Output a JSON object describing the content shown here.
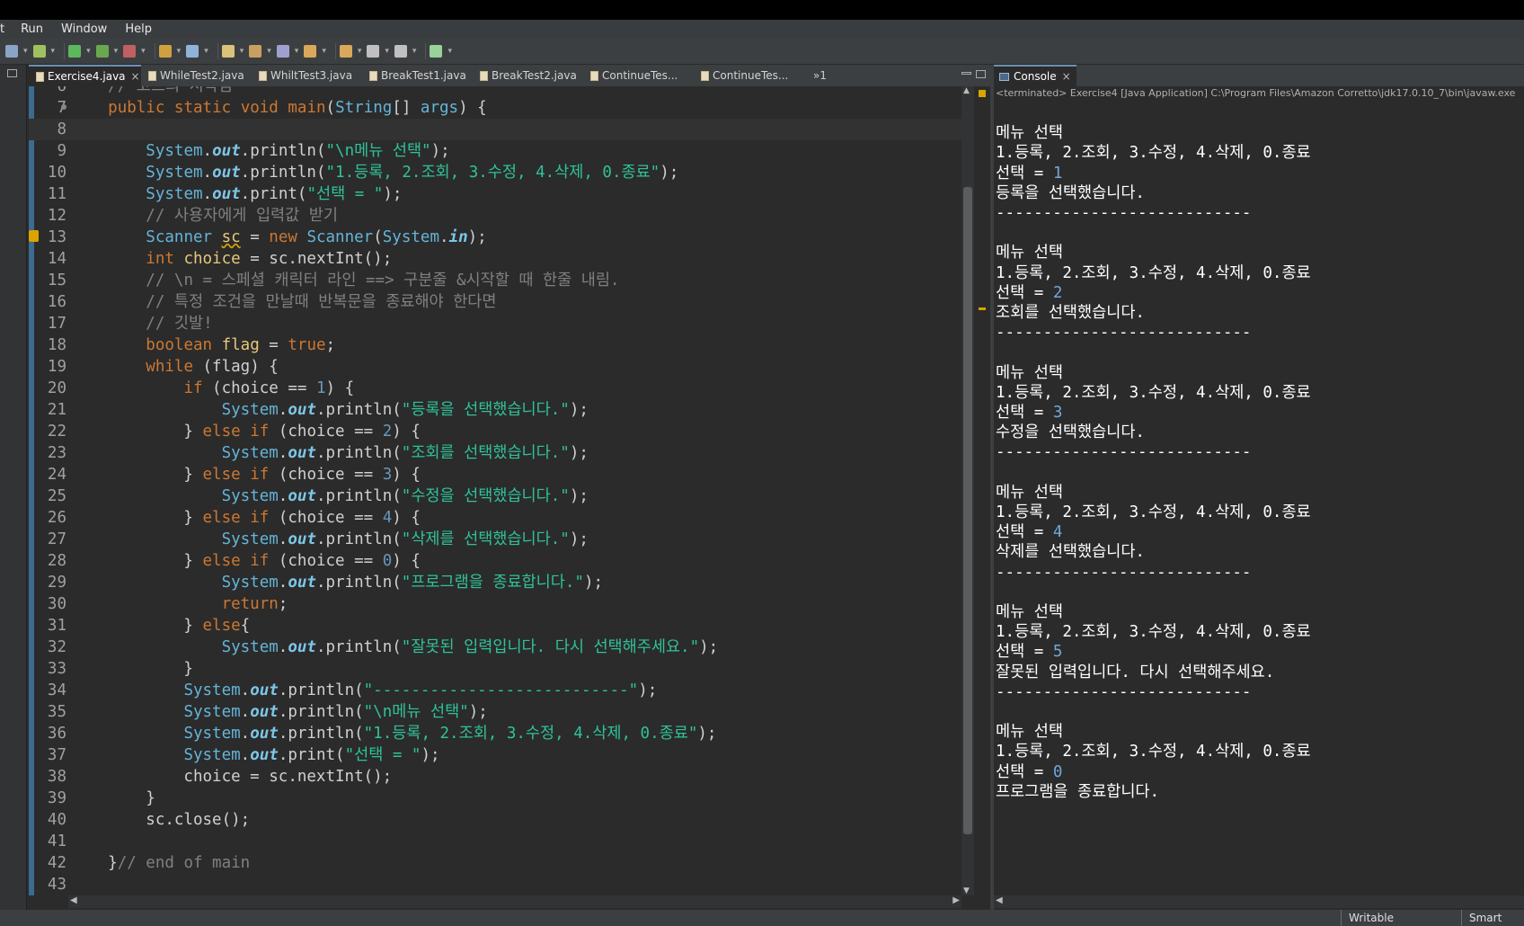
{
  "menu": {
    "items": [
      "t",
      "Run",
      "Window",
      "Help"
    ]
  },
  "editor_tabs": [
    {
      "label": "Exercise4.java",
      "active": true
    },
    {
      "label": "WhileTest2.java"
    },
    {
      "label": "WhiltTest3.java"
    },
    {
      "label": "BreakTest1.java"
    },
    {
      "label": "BreakTest2.java"
    },
    {
      "label": "ContinueTes..."
    },
    {
      "label": "ContinueTes..."
    }
  ],
  "editor_tabs_overflow": "»1",
  "code": {
    "current_line": 8,
    "lines": [
      {
        "n": 6,
        "seg": [
          [
            "    ",
            ""
          ],
          [
            "// 코드의 시작점",
            "cmt"
          ]
        ]
      },
      {
        "n": 7,
        "fold": true,
        "seg": [
          [
            "    ",
            ""
          ],
          [
            "public",
            "kw"
          ],
          [
            " ",
            ""
          ],
          [
            "static",
            "kw"
          ],
          [
            " ",
            ""
          ],
          [
            "void",
            "kw"
          ],
          [
            " ",
            ""
          ],
          [
            "main",
            "kw"
          ],
          [
            "(",
            ""
          ],
          [
            "String",
            "cls"
          ],
          [
            "[] ",
            ""
          ],
          [
            "args",
            "cls"
          ],
          [
            ") {",
            ""
          ]
        ]
      },
      {
        "n": 8,
        "seg": [
          [
            "",
            ""
          ]
        ]
      },
      {
        "n": 9,
        "seg": [
          [
            "        ",
            ""
          ],
          [
            "System",
            "cls"
          ],
          [
            ".",
            ""
          ],
          [
            "out",
            "fld"
          ],
          [
            ".println(",
            ""
          ],
          [
            "\"\\n메뉴 선택\"",
            "str"
          ],
          [
            ");",
            ""
          ]
        ]
      },
      {
        "n": 10,
        "seg": [
          [
            "        ",
            ""
          ],
          [
            "System",
            "cls"
          ],
          [
            ".",
            ""
          ],
          [
            "out",
            "fld"
          ],
          [
            ".println(",
            ""
          ],
          [
            "\"1.등록, 2.조회, 3.수정, 4.삭제, 0.종료\"",
            "str"
          ],
          [
            ");",
            ""
          ]
        ]
      },
      {
        "n": 11,
        "seg": [
          [
            "        ",
            ""
          ],
          [
            "System",
            "cls"
          ],
          [
            ".",
            ""
          ],
          [
            "out",
            "fld"
          ],
          [
            ".print(",
            ""
          ],
          [
            "\"선택 = \"",
            "str"
          ],
          [
            ");",
            ""
          ]
        ]
      },
      {
        "n": 12,
        "seg": [
          [
            "        ",
            ""
          ],
          [
            "// 사용자에게 입력값 받기",
            "cmt"
          ]
        ]
      },
      {
        "n": 13,
        "warn": true,
        "seg": [
          [
            "        ",
            ""
          ],
          [
            "Scanner",
            "cls"
          ],
          [
            " ",
            ""
          ],
          [
            "sc",
            "var"
          ],
          [
            " = ",
            ""
          ],
          [
            "new",
            "kw"
          ],
          [
            " ",
            ""
          ],
          [
            "Scanner",
            "cls"
          ],
          [
            "(",
            ""
          ],
          [
            "System",
            "cls"
          ],
          [
            ".",
            ""
          ],
          [
            "in",
            "fld"
          ],
          [
            ");",
            ""
          ]
        ]
      },
      {
        "n": 14,
        "seg": [
          [
            "        ",
            ""
          ],
          [
            "int",
            "kw"
          ],
          [
            " ",
            ""
          ],
          [
            "choice",
            "var"
          ],
          [
            " = sc.nextInt();",
            ""
          ]
        ]
      },
      {
        "n": 15,
        "seg": [
          [
            "        ",
            ""
          ],
          [
            "// \\n = 스페셜 캐릭터 라인 ==> 구분줄 &시작할 때 한줄 내림.",
            "cmt"
          ]
        ]
      },
      {
        "n": 16,
        "seg": [
          [
            "        ",
            ""
          ],
          [
            "// 특정 조건을 만날때 반복문을 종료해야 한다면",
            "cmt"
          ]
        ]
      },
      {
        "n": 17,
        "seg": [
          [
            "        ",
            ""
          ],
          [
            "// 깃발!",
            "cmt"
          ]
        ]
      },
      {
        "n": 18,
        "seg": [
          [
            "        ",
            ""
          ],
          [
            "boolean",
            "kw"
          ],
          [
            " ",
            ""
          ],
          [
            "flag",
            "var"
          ],
          [
            " = ",
            ""
          ],
          [
            "true",
            "kw"
          ],
          [
            ";",
            ""
          ]
        ]
      },
      {
        "n": 19,
        "seg": [
          [
            "        ",
            ""
          ],
          [
            "while",
            "kw"
          ],
          [
            " (flag) {",
            ""
          ]
        ]
      },
      {
        "n": 20,
        "seg": [
          [
            "            ",
            ""
          ],
          [
            "if",
            "kw"
          ],
          [
            " (choice == ",
            ""
          ],
          [
            "1",
            "num"
          ],
          [
            ") {",
            ""
          ]
        ]
      },
      {
        "n": 21,
        "seg": [
          [
            "                ",
            ""
          ],
          [
            "System",
            "cls"
          ],
          [
            ".",
            ""
          ],
          [
            "out",
            "fld"
          ],
          [
            ".println(",
            ""
          ],
          [
            "\"등록을 선택했습니다.\"",
            "str"
          ],
          [
            ");",
            ""
          ]
        ]
      },
      {
        "n": 22,
        "seg": [
          [
            "            } ",
            ""
          ],
          [
            "else",
            "kw"
          ],
          [
            " ",
            ""
          ],
          [
            "if",
            "kw"
          ],
          [
            " (choice == ",
            ""
          ],
          [
            "2",
            "num"
          ],
          [
            ") {",
            ""
          ]
        ]
      },
      {
        "n": 23,
        "seg": [
          [
            "                ",
            ""
          ],
          [
            "System",
            "cls"
          ],
          [
            ".",
            ""
          ],
          [
            "out",
            "fld"
          ],
          [
            ".println(",
            ""
          ],
          [
            "\"조회를 선택했습니다.\"",
            "str"
          ],
          [
            ");",
            ""
          ]
        ]
      },
      {
        "n": 24,
        "seg": [
          [
            "            } ",
            ""
          ],
          [
            "else",
            "kw"
          ],
          [
            " ",
            ""
          ],
          [
            "if",
            "kw"
          ],
          [
            " (choice == ",
            ""
          ],
          [
            "3",
            "num"
          ],
          [
            ") {",
            ""
          ]
        ]
      },
      {
        "n": 25,
        "seg": [
          [
            "                ",
            ""
          ],
          [
            "System",
            "cls"
          ],
          [
            ".",
            ""
          ],
          [
            "out",
            "fld"
          ],
          [
            ".println(",
            ""
          ],
          [
            "\"수정을 선택했습니다.\"",
            "str"
          ],
          [
            ");",
            ""
          ]
        ]
      },
      {
        "n": 26,
        "seg": [
          [
            "            } ",
            ""
          ],
          [
            "else",
            "kw"
          ],
          [
            " ",
            ""
          ],
          [
            "if",
            "kw"
          ],
          [
            " (choice == ",
            ""
          ],
          [
            "4",
            "num"
          ],
          [
            ") {",
            ""
          ]
        ]
      },
      {
        "n": 27,
        "seg": [
          [
            "                ",
            ""
          ],
          [
            "System",
            "cls"
          ],
          [
            ".",
            ""
          ],
          [
            "out",
            "fld"
          ],
          [
            ".println(",
            ""
          ],
          [
            "\"삭제를 선택했습니다.\"",
            "str"
          ],
          [
            ");",
            ""
          ]
        ]
      },
      {
        "n": 28,
        "seg": [
          [
            "            } ",
            ""
          ],
          [
            "else",
            "kw"
          ],
          [
            " ",
            ""
          ],
          [
            "if",
            "kw"
          ],
          [
            " (choice == ",
            ""
          ],
          [
            "0",
            "num"
          ],
          [
            ") {",
            ""
          ]
        ]
      },
      {
        "n": 29,
        "seg": [
          [
            "                ",
            ""
          ],
          [
            "System",
            "cls"
          ],
          [
            ".",
            ""
          ],
          [
            "out",
            "fld"
          ],
          [
            ".println(",
            ""
          ],
          [
            "\"프로그램을 종료합니다.\"",
            "str"
          ],
          [
            ");",
            ""
          ]
        ]
      },
      {
        "n": 30,
        "seg": [
          [
            "                ",
            ""
          ],
          [
            "return",
            "kw"
          ],
          [
            ";",
            ""
          ]
        ]
      },
      {
        "n": 31,
        "seg": [
          [
            "            } ",
            ""
          ],
          [
            "else",
            "kw"
          ],
          [
            "{",
            ""
          ]
        ]
      },
      {
        "n": 32,
        "seg": [
          [
            "                ",
            ""
          ],
          [
            "System",
            "cls"
          ],
          [
            ".",
            ""
          ],
          [
            "out",
            "fld"
          ],
          [
            ".println(",
            ""
          ],
          [
            "\"잘못된 입력입니다. 다시 선택해주세요.\"",
            "str"
          ],
          [
            ");",
            ""
          ]
        ]
      },
      {
        "n": 33,
        "seg": [
          [
            "            }",
            ""
          ]
        ]
      },
      {
        "n": 34,
        "seg": [
          [
            "            ",
            ""
          ],
          [
            "System",
            "cls"
          ],
          [
            ".",
            ""
          ],
          [
            "out",
            "fld"
          ],
          [
            ".println(",
            ""
          ],
          [
            "\"---------------------------\"",
            "str"
          ],
          [
            ");",
            ""
          ]
        ]
      },
      {
        "n": 35,
        "seg": [
          [
            "            ",
            ""
          ],
          [
            "System",
            "cls"
          ],
          [
            ".",
            ""
          ],
          [
            "out",
            "fld"
          ],
          [
            ".println(",
            ""
          ],
          [
            "\"\\n메뉴 선택\"",
            "str"
          ],
          [
            ");",
            ""
          ]
        ]
      },
      {
        "n": 36,
        "seg": [
          [
            "            ",
            ""
          ],
          [
            "System",
            "cls"
          ],
          [
            ".",
            ""
          ],
          [
            "out",
            "fld"
          ],
          [
            ".println(",
            ""
          ],
          [
            "\"1.등록, 2.조회, 3.수정, 4.삭제, 0.종료\"",
            "str"
          ],
          [
            ");",
            ""
          ]
        ]
      },
      {
        "n": 37,
        "seg": [
          [
            "            ",
            ""
          ],
          [
            "System",
            "cls"
          ],
          [
            ".",
            ""
          ],
          [
            "out",
            "fld"
          ],
          [
            ".print(",
            ""
          ],
          [
            "\"선택 = \"",
            "str"
          ],
          [
            ");",
            ""
          ]
        ]
      },
      {
        "n": 38,
        "seg": [
          [
            "            choice = sc.nextInt();",
            ""
          ]
        ]
      },
      {
        "n": 39,
        "seg": [
          [
            "        }",
            ""
          ]
        ]
      },
      {
        "n": 40,
        "seg": [
          [
            "        sc.close();",
            ""
          ]
        ]
      },
      {
        "n": 41,
        "seg": [
          [
            "",
            ""
          ]
        ]
      },
      {
        "n": 42,
        "seg": [
          [
            "    }",
            ""
          ],
          [
            "// end of main",
            "cmt"
          ]
        ]
      },
      {
        "n": 43,
        "seg": [
          [
            "",
            ""
          ]
        ]
      }
    ]
  },
  "console": {
    "tab_label": "Console",
    "status": "<terminated> Exercise4 [Java Application] C:\\Program Files\\Amazon Corretto\\jdk17.0.10_7\\bin\\javaw.exe",
    "blocks": [
      {
        "menu": "메뉴 선택",
        "options": "1.등록, 2.조회, 3.수정, 4.삭제, 0.종료",
        "prompt": "선택 = ",
        "input": "1",
        "result": "등록을 선택했습니다.",
        "sep": "---------------------------"
      },
      {
        "menu": "메뉴 선택",
        "options": "1.등록, 2.조회, 3.수정, 4.삭제, 0.종료",
        "prompt": "선택 = ",
        "input": "2",
        "result": "조회를 선택했습니다.",
        "sep": "---------------------------"
      },
      {
        "menu": "메뉴 선택",
        "options": "1.등록, 2.조회, 3.수정, 4.삭제, 0.종료",
        "prompt": "선택 = ",
        "input": "3",
        "result": "수정을 선택했습니다.",
        "sep": "---------------------------"
      },
      {
        "menu": "메뉴 선택",
        "options": "1.등록, 2.조회, 3.수정, 4.삭제, 0.종료",
        "prompt": "선택 = ",
        "input": "4",
        "result": "삭제를 선택했습니다.",
        "sep": "---------------------------"
      },
      {
        "menu": "메뉴 선택",
        "options": "1.등록, 2.조회, 3.수정, 4.삭제, 0.종료",
        "prompt": "선택 = ",
        "input": "5",
        "result": "잘못된 입력입니다. 다시 선택해주세요.",
        "sep": "---------------------------"
      },
      {
        "menu": "메뉴 선택",
        "options": "1.등록, 2.조회, 3.수정, 4.삭제, 0.종료",
        "prompt": "선택 = ",
        "input": "0",
        "result": "프로그램을 종료합니다.",
        "sep": ""
      }
    ]
  },
  "statusbar": {
    "writable": "Writable",
    "insert_mode": "Smart Insert"
  },
  "colors": {
    "editor_bg": "#2b2b2b",
    "keyword": "#cc7832",
    "string": "#2fc29a",
    "comment": "#808080",
    "type": "#64b5d9",
    "number": "#6897bb",
    "console_input": "#6fa8dc"
  },
  "toolbar_icons": [
    "toolbar-icon",
    "debug-icon",
    "run-icon",
    "coverage-icon",
    "external-tools-icon",
    "new-java-project-icon",
    "new-package-icon",
    "new-class-icon",
    "open-type-icon",
    "search-icon",
    "prev-annotation-icon",
    "next-annotation-icon",
    "back-icon",
    "forward-icon",
    "perspective-icon"
  ]
}
